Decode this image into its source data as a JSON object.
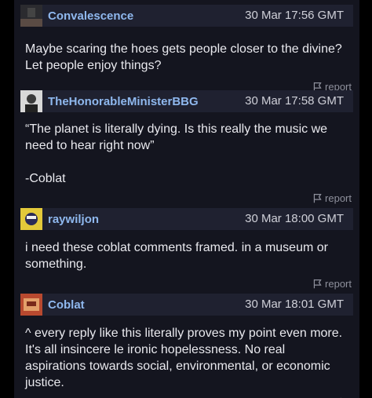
{
  "report_label": "report",
  "comments": [
    {
      "username": "Convalescence",
      "timestamp": "30 Mar 17:56 GMT",
      "paragraphs": [
        "Maybe scaring the hoes gets people closer to the divine? Let people enjoy things?"
      ]
    },
    {
      "username": "TheHonorableMinisterBBG",
      "timestamp": "30 Mar 17:58 GMT",
      "paragraphs": [
        "“The planet is literally dying. Is this really the music we need to hear right now”",
        "-Coblat"
      ]
    },
    {
      "username": "raywiljon",
      "timestamp": "30 Mar 18:00 GMT",
      "paragraphs": [
        "i need these coblat comments framed. in a museum or something."
      ]
    },
    {
      "username": "Coblat",
      "timestamp": "30 Mar 18:01 GMT",
      "paragraphs": [
        "^ every reply like this literally proves my point even more. It's all insincere le ironic hopelessness. No real aspirations towards social, environmental, or economic justice."
      ]
    }
  ]
}
